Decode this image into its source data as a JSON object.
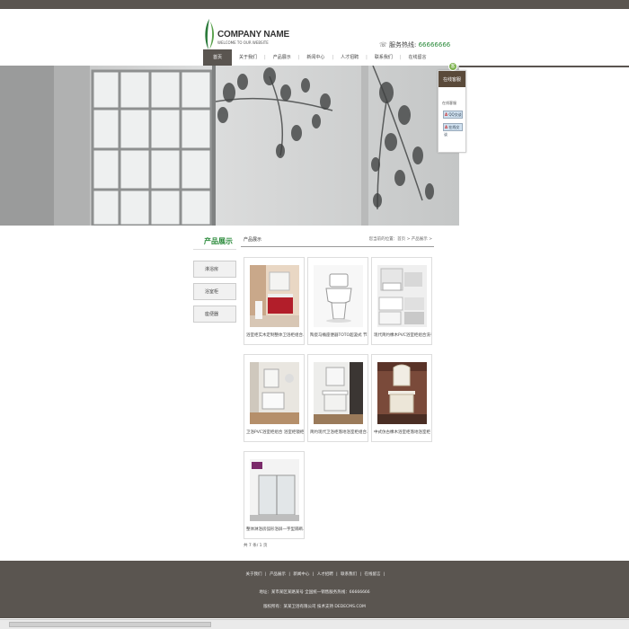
{
  "colors": {
    "brand_dark": "#5a5550",
    "accent_green": "#2a8a3a",
    "kefu_header": "#5a4a3a"
  },
  "header": {
    "company_name": "COMPANY NAME",
    "welcome": "WELCOME TO OUR WEBSITE",
    "hotline_label": "服务热线:",
    "hotline_number": "66666666",
    "hotline_icon": "phone-icon"
  },
  "nav": {
    "items": [
      "首页",
      "关于我们",
      "产品展示",
      "新闻中心",
      "人才招聘",
      "联系我们",
      "在线留言"
    ],
    "active_index": 0
  },
  "kefu": {
    "badge": "客",
    "title": "在线客服",
    "label": "在线客服",
    "buttons": [
      "QQ交谈",
      "在线交谈"
    ]
  },
  "sidebar": {
    "title": "产品展示",
    "items": [
      "淋浴房",
      "浴室柜",
      "座便器"
    ]
  },
  "content": {
    "title": "产品展示",
    "breadcrumb": "您当前的位置：首页 > 产品展示 >",
    "products": [
      "浴室柜实木定制整体卫浴柜组合...",
      "陶瓷马桶座便器TOTO超漩式 节水...",
      "现代简约橡木PVC浴室柜组合洗手...",
      "卫浴PVC浴室柜组合 浴室柜镜柜卫...",
      "简约现代卫浴柜落地浴室柜组合...",
      "中式仿古橡木浴室柜落地浴室柜 洗...",
      "整体淋浴房弧形浴屏一字型隔断..."
    ],
    "count": "共 7 条/ 1 页"
  },
  "footer": {
    "nav": [
      "关于我们",
      "产品展示",
      "新闻中心",
      "人才招聘",
      "联系我们",
      "在线留言"
    ],
    "address_line": "地址：某市某区某路某号    全国统一销售服务热线：66666666",
    "copyright_line": "版权所有：某某卫浴有限公司 技术支持 DEDECMS.COM"
  }
}
